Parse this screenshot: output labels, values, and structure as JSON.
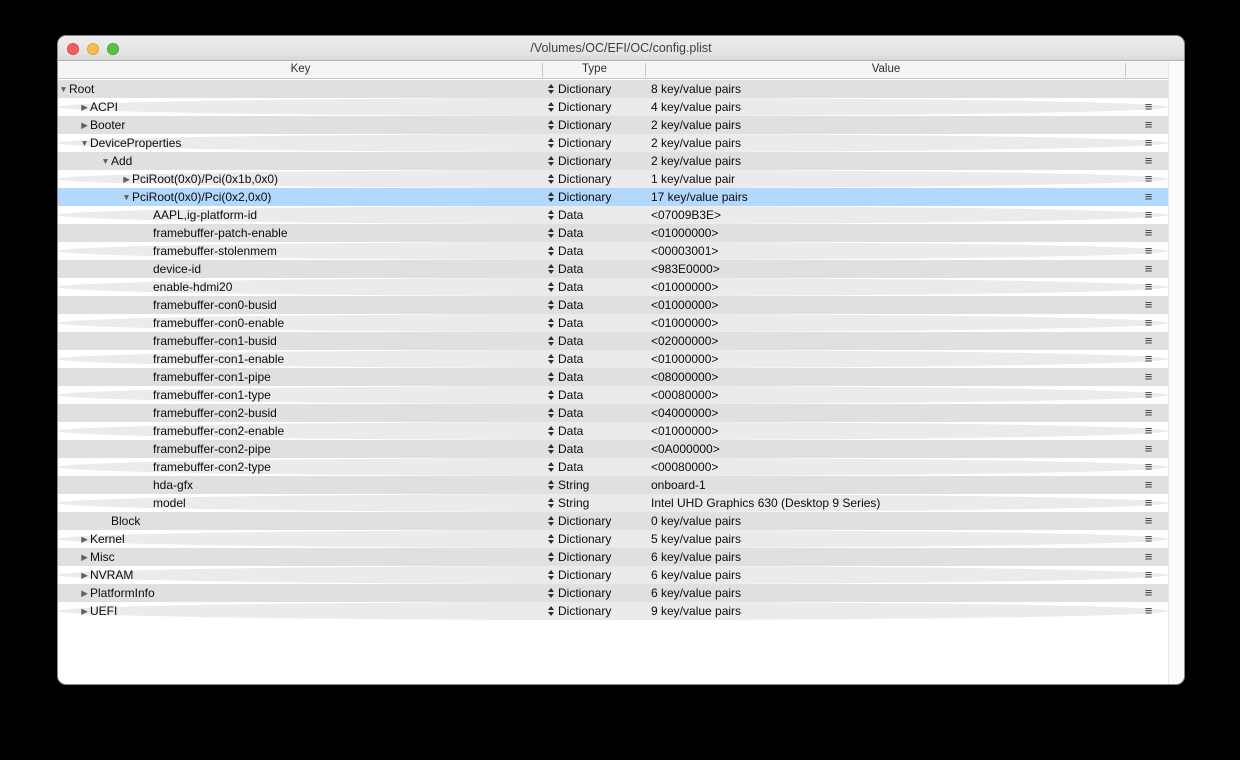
{
  "window": {
    "title": "/Volumes/OC/EFI/OC/config.plist"
  },
  "columns": {
    "key": "Key",
    "type": "Type",
    "value": "Value"
  },
  "icons": {
    "disclosure_expanded": "▼",
    "disclosure_collapsed": "▶",
    "row_menu": "≡",
    "type_stepper": "up-down-arrows"
  },
  "colors": {
    "selection": "#b3d8fd",
    "row_dark": "#e0e0e0",
    "row_light": "#ebebeb",
    "traffic_red": "#f1605a",
    "traffic_yellow": "#f5bd4f",
    "traffic_green": "#57c343"
  },
  "rows": [
    {
      "key": "Root",
      "type": "Dictionary",
      "value": "8 key/value pairs",
      "level": 0,
      "disclosure": "expanded",
      "selected": false,
      "menu": false
    },
    {
      "key": "ACPI",
      "type": "Dictionary",
      "value": "4 key/value pairs",
      "level": 1,
      "disclosure": "collapsed",
      "selected": false,
      "menu": true
    },
    {
      "key": "Booter",
      "type": "Dictionary",
      "value": "2 key/value pairs",
      "level": 1,
      "disclosure": "collapsed",
      "selected": false,
      "menu": true
    },
    {
      "key": "DeviceProperties",
      "type": "Dictionary",
      "value": "2 key/value pairs",
      "level": 1,
      "disclosure": "expanded",
      "selected": false,
      "menu": true
    },
    {
      "key": "Add",
      "type": "Dictionary",
      "value": "2 key/value pairs",
      "level": 2,
      "disclosure": "expanded",
      "selected": false,
      "menu": true
    },
    {
      "key": "PciRoot(0x0)/Pci(0x1b,0x0)",
      "type": "Dictionary",
      "value": "1 key/value pair",
      "level": 3,
      "disclosure": "collapsed",
      "selected": false,
      "menu": true
    },
    {
      "key": "PciRoot(0x0)/Pci(0x2,0x0)",
      "type": "Dictionary",
      "value": "17 key/value pairs",
      "level": 3,
      "disclosure": "expanded",
      "selected": true,
      "menu": true
    },
    {
      "key": "AAPL,ig-platform-id",
      "type": "Data",
      "value": "<07009B3E>",
      "level": 4,
      "disclosure": "none",
      "selected": false,
      "menu": true
    },
    {
      "key": "framebuffer-patch-enable",
      "type": "Data",
      "value": "<01000000>",
      "level": 4,
      "disclosure": "none",
      "selected": false,
      "menu": true
    },
    {
      "key": "framebuffer-stolenmem",
      "type": "Data",
      "value": "<00003001>",
      "level": 4,
      "disclosure": "none",
      "selected": false,
      "menu": true
    },
    {
      "key": "device-id",
      "type": "Data",
      "value": "<983E0000>",
      "level": 4,
      "disclosure": "none",
      "selected": false,
      "menu": true
    },
    {
      "key": "enable-hdmi20",
      "type": "Data",
      "value": "<01000000>",
      "level": 4,
      "disclosure": "none",
      "selected": false,
      "menu": true
    },
    {
      "key": "framebuffer-con0-busid",
      "type": "Data",
      "value": "<01000000>",
      "level": 4,
      "disclosure": "none",
      "selected": false,
      "menu": true
    },
    {
      "key": "framebuffer-con0-enable",
      "type": "Data",
      "value": "<01000000>",
      "level": 4,
      "disclosure": "none",
      "selected": false,
      "menu": true
    },
    {
      "key": "framebuffer-con1-busid",
      "type": "Data",
      "value": "<02000000>",
      "level": 4,
      "disclosure": "none",
      "selected": false,
      "menu": true
    },
    {
      "key": "framebuffer-con1-enable",
      "type": "Data",
      "value": "<01000000>",
      "level": 4,
      "disclosure": "none",
      "selected": false,
      "menu": true
    },
    {
      "key": "framebuffer-con1-pipe",
      "type": "Data",
      "value": "<08000000>",
      "level": 4,
      "disclosure": "none",
      "selected": false,
      "menu": true
    },
    {
      "key": "framebuffer-con1-type",
      "type": "Data",
      "value": "<00080000>",
      "level": 4,
      "disclosure": "none",
      "selected": false,
      "menu": true
    },
    {
      "key": "framebuffer-con2-busid",
      "type": "Data",
      "value": "<04000000>",
      "level": 4,
      "disclosure": "none",
      "selected": false,
      "menu": true
    },
    {
      "key": "framebuffer-con2-enable",
      "type": "Data",
      "value": "<01000000>",
      "level": 4,
      "disclosure": "none",
      "selected": false,
      "menu": true
    },
    {
      "key": "framebuffer-con2-pipe",
      "type": "Data",
      "value": "<0A000000>",
      "level": 4,
      "disclosure": "none",
      "selected": false,
      "menu": true
    },
    {
      "key": "framebuffer-con2-type",
      "type": "Data",
      "value": "<00080000>",
      "level": 4,
      "disclosure": "none",
      "selected": false,
      "menu": true
    },
    {
      "key": "hda-gfx",
      "type": "String",
      "value": "onboard-1",
      "level": 4,
      "disclosure": "none",
      "selected": false,
      "menu": true
    },
    {
      "key": "model",
      "type": "String",
      "value": "Intel UHD Graphics 630 (Desktop 9 Series)",
      "level": 4,
      "disclosure": "none",
      "selected": false,
      "menu": true
    },
    {
      "key": "Block",
      "type": "Dictionary",
      "value": "0 key/value pairs",
      "level": 2,
      "disclosure": "none",
      "selected": false,
      "menu": true
    },
    {
      "key": "Kernel",
      "type": "Dictionary",
      "value": "5 key/value pairs",
      "level": 1,
      "disclosure": "collapsed",
      "selected": false,
      "menu": true
    },
    {
      "key": "Misc",
      "type": "Dictionary",
      "value": "6 key/value pairs",
      "level": 1,
      "disclosure": "collapsed",
      "selected": false,
      "menu": true
    },
    {
      "key": "NVRAM",
      "type": "Dictionary",
      "value": "6 key/value pairs",
      "level": 1,
      "disclosure": "collapsed",
      "selected": false,
      "menu": true
    },
    {
      "key": "PlatformInfo",
      "type": "Dictionary",
      "value": "6 key/value pairs",
      "level": 1,
      "disclosure": "collapsed",
      "selected": false,
      "menu": true
    },
    {
      "key": "UEFI",
      "type": "Dictionary",
      "value": "9 key/value pairs",
      "level": 1,
      "disclosure": "collapsed",
      "selected": false,
      "menu": true
    }
  ]
}
